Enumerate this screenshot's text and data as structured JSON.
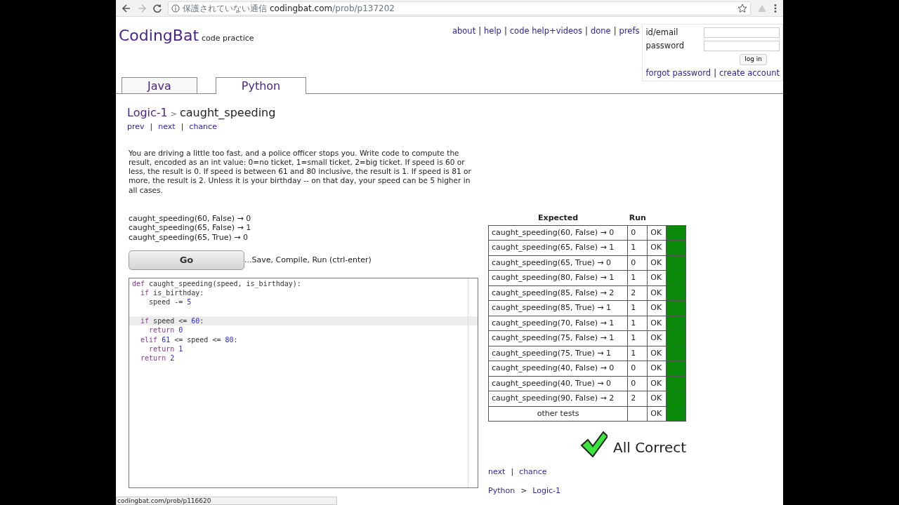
{
  "browser": {
    "security": "保護されていない通信",
    "url_host": "codingbat.com",
    "url_path": "/prob/p137202"
  },
  "header": {
    "logo": "CodingBat",
    "tagline": "code practice",
    "nav_links": [
      "about",
      "help",
      "code help+videos",
      "done",
      "prefs"
    ],
    "separator": "|",
    "login": {
      "fields": [
        {
          "label": "id/email"
        },
        {
          "label": "password"
        }
      ],
      "button": "log in",
      "links": [
        "forgot password",
        "create account"
      ],
      "separator": "|"
    }
  },
  "tabs": [
    {
      "label": "Java",
      "selected": false
    },
    {
      "label": "Python",
      "selected": true
    }
  ],
  "problem": {
    "section": "Logic-1",
    "separator": ">",
    "title": "caught_speeding",
    "nav": [
      "prev",
      "next",
      "chance"
    ],
    "nav_separator": "|",
    "description": "You are driving a little too fast, and a police officer stops you. Write code to compute the result, encoded as an int value: 0=no ticket, 1=small ticket, 2=big ticket. If speed is 60 or less, the result is 0. If speed is between 61 and 80 inclusive, the result is 1. If speed is 81 or more, the result is 2. Unless it is your birthday -- on that day, your speed can be 5 higher in all cases.",
    "examples": [
      "caught_speeding(60, False) → 0",
      "caught_speeding(65, False) → 1",
      "caught_speeding(65, True) → 0"
    ],
    "go_button": "Go",
    "go_hint": "...Save, Compile, Run (ctrl-enter)"
  },
  "code": {
    "lines": [
      {
        "highlighted": false,
        "segments": [
          {
            "kind": "keyword",
            "text": "def"
          },
          {
            "kind": "plain",
            "text": " caught_speeding(speed, is_birthday):"
          }
        ]
      },
      {
        "highlighted": false,
        "segments": [
          {
            "kind": "keyword",
            "text": "  if"
          },
          {
            "kind": "plain",
            "text": " is_birthday:"
          }
        ]
      },
      {
        "highlighted": false,
        "segments": [
          {
            "kind": "plain",
            "text": "    speed -= "
          },
          {
            "kind": "number",
            "text": "5"
          }
        ]
      },
      {
        "highlighted": false
      },
      {
        "highlighted": true,
        "segments": [
          {
            "kind": "keyword",
            "text": "  if"
          },
          {
            "kind": "plain",
            "text": " speed <= "
          },
          {
            "kind": "number",
            "text": "60"
          },
          {
            "kind": "plain",
            "text": ":"
          }
        ]
      },
      {
        "highlighted": false,
        "segments": [
          {
            "kind": "keyword",
            "text": "    return"
          },
          {
            "kind": "number",
            "text": " 0"
          }
        ]
      },
      {
        "highlighted": false,
        "segments": [
          {
            "kind": "keyword",
            "text": "  elif"
          },
          {
            "kind": "number",
            "text": " 61"
          },
          {
            "kind": "plain",
            "text": " <= speed <= "
          },
          {
            "kind": "number",
            "text": "80"
          },
          {
            "kind": "plain",
            "text": ":"
          }
        ]
      },
      {
        "highlighted": false,
        "segments": [
          {
            "kind": "keyword",
            "text": "    return"
          },
          {
            "kind": "number",
            "text": " 1"
          }
        ]
      },
      {
        "highlighted": false,
        "segments": [
          {
            "kind": "keyword",
            "text": "  return"
          },
          {
            "kind": "number",
            "text": " 2"
          }
        ]
      }
    ]
  },
  "results": {
    "columns": [
      "Expected",
      "Run"
    ],
    "rows": [
      {
        "expected": "caught_speeding(60, False) → 0",
        "run": "0",
        "status": "OK",
        "passed": true
      },
      {
        "expected": "caught_speeding(65, False) → 1",
        "run": "1",
        "status": "OK",
        "passed": true
      },
      {
        "expected": "caught_speeding(65, True) → 0",
        "run": "0",
        "status": "OK",
        "passed": true
      },
      {
        "expected": "caught_speeding(80, False) → 1",
        "run": "1",
        "status": "OK",
        "passed": true
      },
      {
        "expected": "caught_speeding(85, False) → 2",
        "run": "2",
        "status": "OK",
        "passed": true
      },
      {
        "expected": "caught_speeding(85, True) → 1",
        "run": "1",
        "status": "OK",
        "passed": true
      },
      {
        "expected": "caught_speeding(70, False) → 1",
        "run": "1",
        "status": "OK",
        "passed": true
      },
      {
        "expected": "caught_speeding(75, False) → 1",
        "run": "1",
        "status": "OK",
        "passed": true
      },
      {
        "expected": "caught_speeding(75, True) → 1",
        "run": "1",
        "status": "OK",
        "passed": true
      },
      {
        "expected": "caught_speeding(40, False) → 0",
        "run": "0",
        "status": "OK",
        "passed": true
      },
      {
        "expected": "caught_speeding(40, True) → 0",
        "run": "0",
        "status": "OK",
        "passed": true
      },
      {
        "expected": "caught_speeding(90, False) → 2",
        "run": "2",
        "status": "OK",
        "passed": true
      },
      {
        "expected": "other tests",
        "status": "OK",
        "passed": true
      }
    ],
    "verdict": "All Correct",
    "all_correct": true,
    "nav": [
      "next",
      "chance"
    ],
    "nav_separator": "|",
    "breadcrumb": [
      "Python",
      ">",
      "Logic-1"
    ]
  },
  "status_bar": "codingbat.com/prob/p116620"
}
